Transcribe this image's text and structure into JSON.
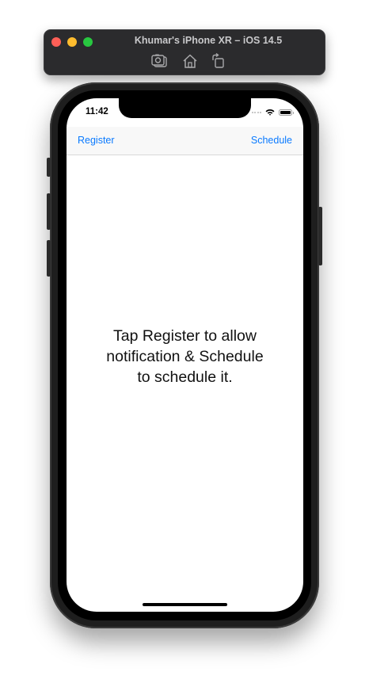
{
  "simulator": {
    "title": "Khumar's iPhone XR – iOS 14.5",
    "toolbar": {
      "screenshot_icon": "camera-icon",
      "home_icon": "home-icon",
      "rotate_icon": "rotate-icon"
    }
  },
  "status_bar": {
    "time": "11:42",
    "icons": [
      "signal-icon",
      "wifi-icon",
      "battery-icon"
    ]
  },
  "navbar": {
    "left_label": "Register",
    "right_label": "Schedule"
  },
  "main": {
    "message_line1": "Tap Register to allow",
    "message_line2": "notification & Schedule",
    "message_line3": "to schedule it."
  },
  "colors": {
    "accent": "#0a7aff",
    "close": "#fe5f57",
    "minimize": "#febc2e",
    "zoom": "#28c840"
  }
}
